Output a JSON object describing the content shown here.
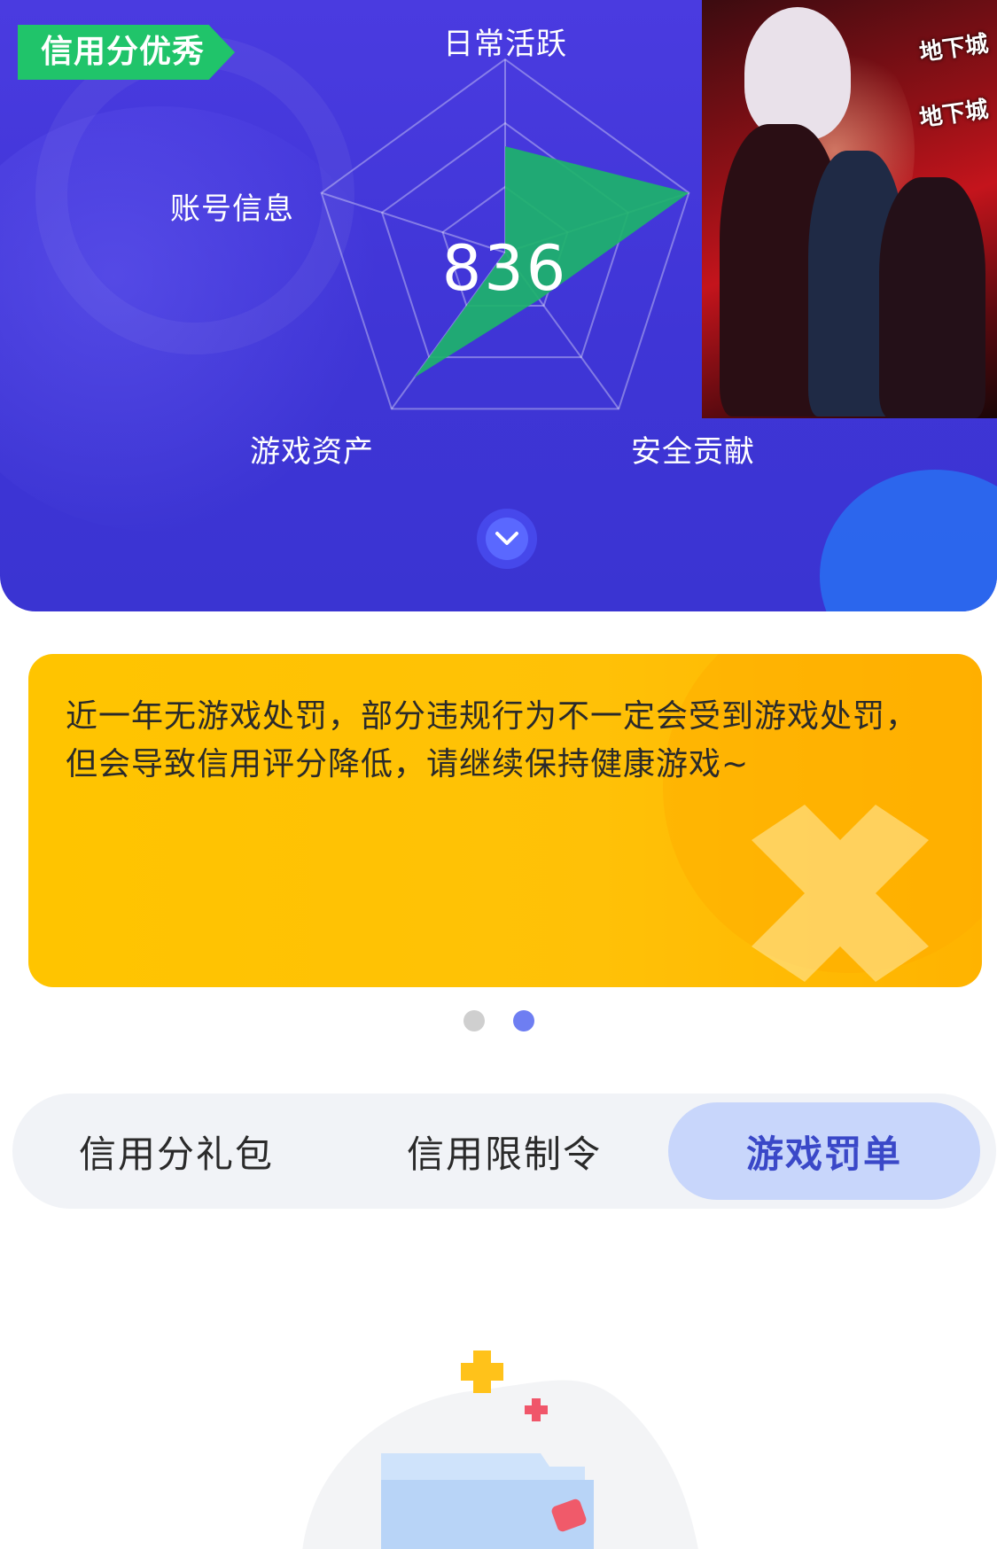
{
  "header": {
    "badge": "信用分优秀",
    "score": "836",
    "radar": {
      "axes": [
        "日常活跃",
        "安全贡献",
        "游戏资产",
        "账号信息"
      ],
      "axis_ids": [
        "daily",
        "security",
        "assets",
        "account"
      ],
      "values": [
        0.55,
        1.0,
        0.3,
        0.8,
        0.0
      ]
    }
  },
  "notice": {
    "text": "近一年无游戏处罚，部分违规行为不一定会受到游戏处罚，但会导致信用评分降低，请继续保持健康游戏~"
  },
  "carousel": {
    "count": 2,
    "active": 1
  },
  "tabs": [
    {
      "label": "信用分礼包"
    },
    {
      "label": "信用限制令"
    },
    {
      "label": "游戏罚单",
      "active": true
    }
  ],
  "colors": {
    "header_bg": "#4136d8",
    "badge_bg": "#20c46a",
    "radar_fill": "#1db36b",
    "notice_bg": "#ffc400",
    "tab_active_bg": "#c8d6fb",
    "tab_active_text": "#3a48c8",
    "dot_active": "#6e7ef2"
  },
  "icons": [
    "chevron-down-icon",
    "folder-illustration"
  ]
}
